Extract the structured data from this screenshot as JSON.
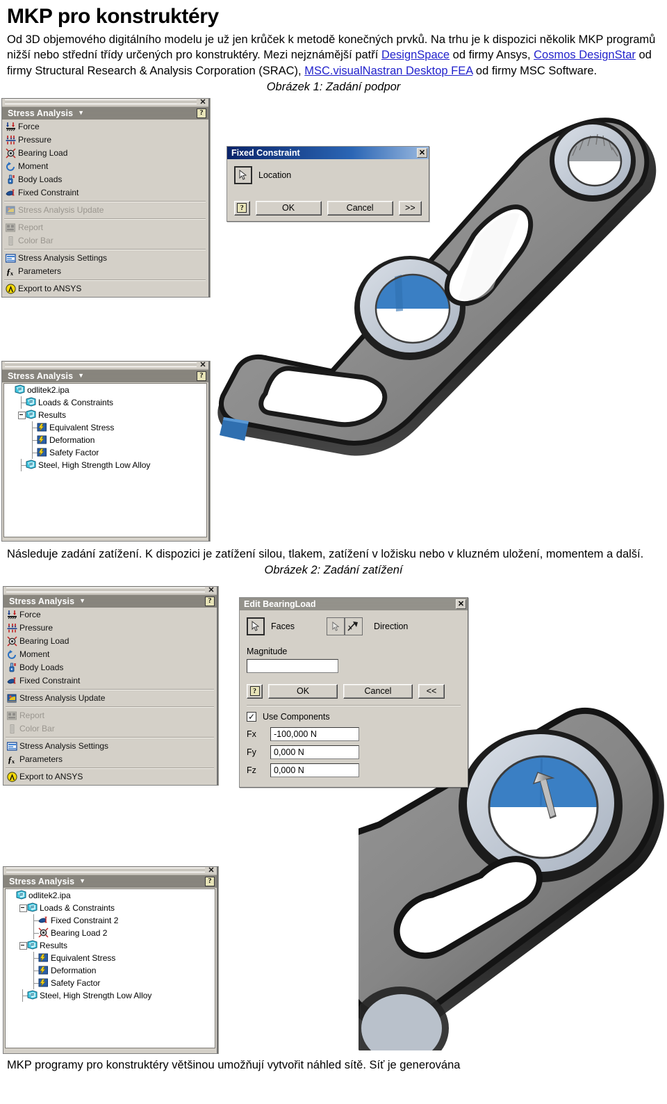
{
  "document": {
    "title": "MKP pro konstruktéry",
    "paragraph1_parts": [
      {
        "t": "Od 3D objemového digitálního modelu je už jen krůček k metodě konečných prvků. Na trhu je k dispozici několik MKP programů nižší nebo střední třídy určených pro konstruktéry. Mezi nejznámější patří ",
        "link": false
      },
      {
        "t": "DesignSpace",
        "link": true
      },
      {
        "t": " od firmy Ansys, ",
        "link": false
      },
      {
        "t": "Cosmos DesignStar",
        "link": true
      },
      {
        "t": " od firmy Structural Research & Analysis Corporation (SRAC), ",
        "link": false
      },
      {
        "t": "MSC.visualNastran Desktop FEA",
        "link": true
      },
      {
        "t": " od firmy MSC Software.",
        "link": false
      }
    ],
    "caption1": "Obrázek 1: Zadání podpor",
    "paragraph2": "Následuje zadání zatížení. K dispozici je zatížení silou, tlakem, zatížení v ložisku nebo v kluzném uložení, momentem a další.",
    "caption2": "Obrázek 2: Zadání zatížení",
    "paragraph3": "MKP programy pro konstruktéry většinou umožňují vytvořit náhled sítě. Síť je generována",
    "link_color": "#2222cc"
  },
  "figure1": {
    "toolbar_panel": {
      "title": "Stress Analysis",
      "caret": "▼",
      "help_label": "?",
      "close_label": "✕",
      "groups": [
        {
          "items": [
            {
              "label": "Force",
              "icon": "force-icon",
              "disabled": false
            },
            {
              "label": "Pressure",
              "icon": "pressure-icon",
              "disabled": false
            },
            {
              "label": "Bearing Load",
              "icon": "bearing-load-icon",
              "disabled": false
            },
            {
              "label": "Moment",
              "icon": "moment-icon",
              "disabled": false
            },
            {
              "label": "Body Loads",
              "icon": "body-loads-icon",
              "disabled": false
            },
            {
              "label": "Fixed Constraint",
              "icon": "fixed-constraint-icon",
              "disabled": false
            }
          ]
        },
        {
          "items": [
            {
              "label": "Stress Analysis Update",
              "icon": "update-icon",
              "disabled": true
            }
          ]
        },
        {
          "items": [
            {
              "label": "Report",
              "icon": "report-icon",
              "disabled": true
            },
            {
              "label": "Color Bar",
              "icon": "color-bar-icon",
              "disabled": true
            }
          ]
        },
        {
          "items": [
            {
              "label": "Stress Analysis Settings",
              "icon": "settings-icon",
              "disabled": false
            },
            {
              "label": "Parameters",
              "icon": "fx-icon",
              "disabled": false
            }
          ]
        },
        {
          "items": [
            {
              "label": "Export to ANSYS",
              "icon": "ansys-icon",
              "disabled": false
            }
          ]
        }
      ]
    },
    "tree_panel": {
      "title": "Stress Analysis",
      "caret": "▼",
      "help_label": "?",
      "close_label": "✕",
      "nodes": [
        {
          "label": "odlitek2.ipa",
          "indent": 0,
          "icon": "doc-icon",
          "expander": "none"
        },
        {
          "label": "Loads & Constraints",
          "indent": 1,
          "icon": "doc-icon",
          "expander": "none"
        },
        {
          "label": "Results",
          "indent": 1,
          "icon": "doc-icon",
          "expander": "minus"
        },
        {
          "label": "Equivalent Stress",
          "indent": 2,
          "icon": "result-icon",
          "expander": "none"
        },
        {
          "label": "Deformation",
          "indent": 2,
          "icon": "result-icon",
          "expander": "none"
        },
        {
          "label": "Safety Factor",
          "indent": 2,
          "icon": "result-icon",
          "expander": "none"
        },
        {
          "label": "Steel, High Strength Low Alloy",
          "indent": 1,
          "icon": "doc-icon",
          "expander": "none"
        }
      ]
    },
    "dialog": {
      "title": "Fixed Constraint",
      "close_label": "✕",
      "select_label": "Location",
      "help_label": "?",
      "ok_label": "OK",
      "cancel_label": "Cancel",
      "more_label": ">>"
    }
  },
  "figure2": {
    "toolbar_panel": {
      "title": "Stress Analysis",
      "caret": "▼",
      "help_label": "?",
      "close_label": "✕",
      "groups": [
        {
          "items": [
            {
              "label": "Force",
              "icon": "force-icon",
              "disabled": false
            },
            {
              "label": "Pressure",
              "icon": "pressure-icon",
              "disabled": false
            },
            {
              "label": "Bearing Load",
              "icon": "bearing-load-icon",
              "disabled": false
            },
            {
              "label": "Moment",
              "icon": "moment-icon",
              "disabled": false
            },
            {
              "label": "Body Loads",
              "icon": "body-loads-icon",
              "disabled": false
            },
            {
              "label": "Fixed Constraint",
              "icon": "fixed-constraint-icon",
              "disabled": false
            }
          ]
        },
        {
          "items": [
            {
              "label": "Stress Analysis Update",
              "icon": "update-icon",
              "disabled": false
            }
          ]
        },
        {
          "items": [
            {
              "label": "Report",
              "icon": "report-icon",
              "disabled": true
            },
            {
              "label": "Color Bar",
              "icon": "color-bar-icon",
              "disabled": true
            }
          ]
        },
        {
          "items": [
            {
              "label": "Stress Analysis Settings",
              "icon": "settings-icon",
              "disabled": false
            },
            {
              "label": "Parameters",
              "icon": "fx-icon",
              "disabled": false
            }
          ]
        },
        {
          "items": [
            {
              "label": "Export to ANSYS",
              "icon": "ansys-icon",
              "disabled": false
            }
          ]
        }
      ]
    },
    "tree_panel": {
      "title": "Stress Analysis",
      "caret": "▼",
      "help_label": "?",
      "close_label": "✕",
      "nodes": [
        {
          "label": "odlitek2.ipa",
          "indent": 0,
          "icon": "doc-icon",
          "expander": "none"
        },
        {
          "label": "Loads & Constraints",
          "indent": 1,
          "icon": "doc-icon",
          "expander": "minus"
        },
        {
          "label": "Fixed Constraint 2",
          "indent": 2,
          "icon": "fixed-constraint-icon",
          "expander": "none"
        },
        {
          "label": "Bearing Load 2",
          "indent": 2,
          "icon": "bearing-load-icon",
          "expander": "none"
        },
        {
          "label": "Results",
          "indent": 1,
          "icon": "doc-icon",
          "expander": "minus"
        },
        {
          "label": "Equivalent Stress",
          "indent": 2,
          "icon": "result-icon",
          "expander": "none"
        },
        {
          "label": "Deformation",
          "indent": 2,
          "icon": "result-icon",
          "expander": "none"
        },
        {
          "label": "Safety Factor",
          "indent": 2,
          "icon": "result-icon",
          "expander": "none"
        },
        {
          "label": "Steel, High Strength Low Alloy",
          "indent": 1,
          "icon": "doc-icon",
          "expander": "none"
        }
      ]
    },
    "dialog": {
      "title": "Edit BearingLoad",
      "close_label": "✕",
      "faces_label": "Faces",
      "direction_label": "Direction",
      "magnitude_label": "Magnitude",
      "magnitude_value": "",
      "help_label": "?",
      "ok_label": "OK",
      "cancel_label": "Cancel",
      "less_label": "<<",
      "use_components_label": "Use Components",
      "use_components_checked": "✓",
      "components": [
        {
          "label": "Fx",
          "value": "-100,000 N"
        },
        {
          "label": "Fy",
          "value": "0,000 N"
        },
        {
          "label": "Fz",
          "value": "0,000 N"
        }
      ]
    }
  },
  "colors": {
    "panel_bg": "#d4d0c8",
    "panel_title_bg": "#838078",
    "dialog_title_blue": "#0a246a",
    "model_body": "#8e8e8e",
    "model_dark": "#2a2a2a",
    "model_blue": "#3a7fc4",
    "model_light_rim": "#c5cdd8"
  }
}
